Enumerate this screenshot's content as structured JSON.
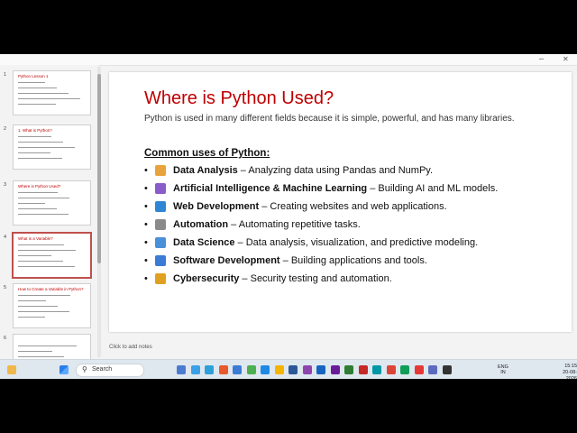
{
  "slide": {
    "title": "Where is Python Used?",
    "intro": "Python is used in many different fields because it is simple, powerful, and has many libraries.",
    "subhead": "Common uses of Python:",
    "bullets": [
      {
        "icon": "bar-chart-icon",
        "color": "#e8a33c",
        "name": "Data Analysis",
        "desc": " – Analyzing data using Pandas and NumPy."
      },
      {
        "icon": "robot-icon",
        "color": "#8a5cc9",
        "name": "Artificial Intelligence & Machine Learning",
        "desc": " – Building AI and ML models."
      },
      {
        "icon": "globe-icon",
        "color": "#2f86d4",
        "name": "Web Development",
        "desc": " – Creating websites and web applications."
      },
      {
        "icon": "gear-icon",
        "color": "#8a8a8a",
        "name": "Automation",
        "desc": " – Automating repetitive tasks."
      },
      {
        "icon": "trend-chart-icon",
        "color": "#4a90d9",
        "name": "Data Science",
        "desc": " – Data analysis, visualization, and predictive modeling."
      },
      {
        "icon": "computer-icon",
        "color": "#3a7bd5",
        "name": "Software Development",
        "desc": " – Building applications and tools."
      },
      {
        "icon": "lock-icon",
        "color": "#e0a020",
        "name": "Cybersecurity",
        "desc": " – Security testing and automation."
      }
    ],
    "bullet_char": "•"
  },
  "thumbnails": [
    {
      "num": "1",
      "title": "Python Lesson 1"
    },
    {
      "num": "2",
      "title": "1. What is Python?"
    },
    {
      "num": "3",
      "title": "Where is Python Used?"
    },
    {
      "num": "4",
      "title": "What is a Variable?"
    },
    {
      "num": "5",
      "title": "How to Create a Variable in Python?"
    },
    {
      "num": "6",
      "title": ""
    }
  ],
  "notes_placeholder": "Click to add notes",
  "taskbar": {
    "search_label": "Search",
    "search_icon": "search-icon",
    "lang_top": "ENG",
    "lang_bottom": "IN",
    "time": "15:15",
    "date": "20-08-2026"
  },
  "colors": {
    "accent": "#c00000",
    "thumb_active": "#c0504d"
  }
}
